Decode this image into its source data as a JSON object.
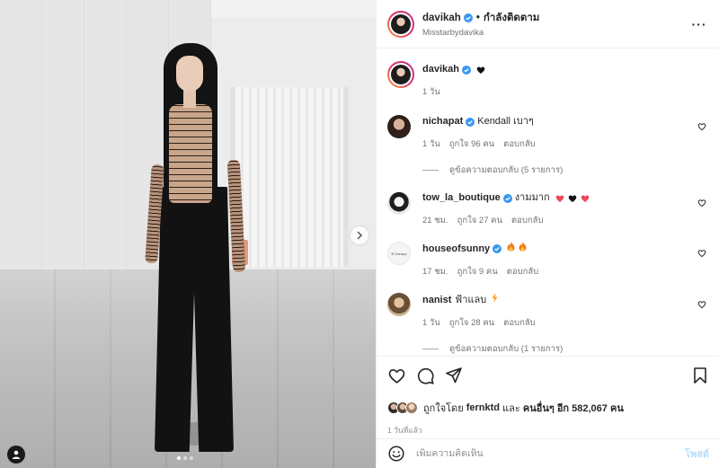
{
  "post": {
    "author": "davikah",
    "follow_status": "กำลังติดตาม",
    "subtitle": "Misstarbydavika",
    "caption_user": "davikah",
    "caption_time": "1 วัน",
    "carousel_pages": 3,
    "carousel_active_index": 0
  },
  "comments": [
    {
      "user": "nichapat",
      "verified": true,
      "text": "Kendall เบาๆ",
      "time": "1 วัน",
      "likes": "ถูกใจ 96 คน",
      "reply_label": "ตอบกลับ",
      "view_replies": "ดูข้อความตอบกลับ (5 รายการ)",
      "avatar_color": "#3a2a22"
    },
    {
      "user": "tow_la_boutique",
      "verified": true,
      "text": "งามมาก",
      "time": "21 ชม.",
      "likes": "ถูกใจ 27 คน",
      "reply_label": "ตอบกลับ",
      "avatar_color": "#222222"
    },
    {
      "user": "houseofsunny",
      "verified": true,
      "text": "",
      "time": "17 ชม.",
      "likes": "ถูกใจ 9 คน",
      "reply_label": "ตอบกลับ",
      "avatar_color": "#f2f2f2"
    },
    {
      "user": "nanist",
      "verified": false,
      "text": "ฟ้าแลบ",
      "time": "1 วัน",
      "likes": "ถูกใจ 28 คน",
      "reply_label": "ตอบกลับ",
      "view_replies": "ดูข้อความตอบกลับ (1 รายการ)",
      "avatar_color": "#8a6a4a"
    }
  ],
  "likes": {
    "prefix": "ถูกใจโดย",
    "user": "fernktd",
    "and": "และ",
    "others": "คนอื่นๆ อีก 582,067 คน"
  },
  "date": "1 วันที่แล้ว",
  "composer": {
    "placeholder": "เพิ่มความคิดเห็น",
    "post_label": "โพสต์"
  },
  "colors": {
    "verified_blue": "#3897f0",
    "heart_red": "#ed4956",
    "post_btn_disabled": "#b2dffc",
    "text_secondary": "#737373"
  },
  "icons": [
    "like-icon",
    "comment-icon",
    "share-icon",
    "save-icon",
    "emoji-icon",
    "more-icon",
    "next-arrow-icon",
    "user-tag-icon"
  ]
}
